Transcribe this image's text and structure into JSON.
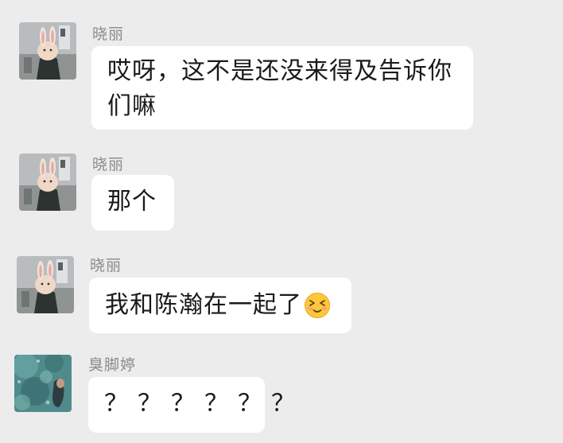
{
  "messages": [
    {
      "sender": "晓丽",
      "avatar": "rabbit-mask-avatar",
      "lines": [
        "哎呀，这不是还没来得及告诉你",
        "们嘛"
      ]
    },
    {
      "sender": "晓丽",
      "avatar": "rabbit-mask-avatar",
      "lines": [
        "那个"
      ]
    },
    {
      "sender": "晓丽",
      "avatar": "rabbit-mask-avatar",
      "text": "我和陈瀚在一起了",
      "emoji": "blushing-squint-face-emoji"
    },
    {
      "sender": "臭脚婷",
      "avatar": "underwater-photo-avatar",
      "text": "？？？？？？"
    }
  ],
  "colors": {
    "background": "#ececec",
    "bubble": "#ffffff",
    "sender_name": "#8a8a8a",
    "message_text": "#1a1a1a"
  }
}
